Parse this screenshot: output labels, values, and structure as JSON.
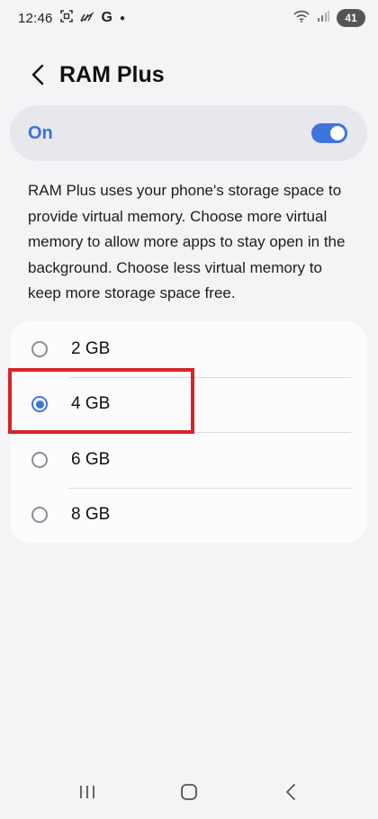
{
  "status_bar": {
    "time": "12:46",
    "carrier_icon": "G",
    "battery": "41"
  },
  "header": {
    "title": "RAM Plus"
  },
  "toggle": {
    "label": "On",
    "state": "on",
    "accent_color": "#3f74dc"
  },
  "description": "RAM Plus uses your phone's storage space to provide virtual memory. Choose more virtual memory to allow more apps to stay open in the background. Choose less virtual memory to keep more storage space free.",
  "options": [
    {
      "label": "2 GB",
      "selected": false
    },
    {
      "label": "4 GB",
      "selected": true
    },
    {
      "label": "6 GB",
      "selected": false
    },
    {
      "label": "8 GB",
      "selected": false
    }
  ],
  "highlight_color": "#d8232a",
  "nav": {
    "recents_icon": "recents-icon",
    "home_icon": "home-icon",
    "back_icon": "back-icon"
  }
}
